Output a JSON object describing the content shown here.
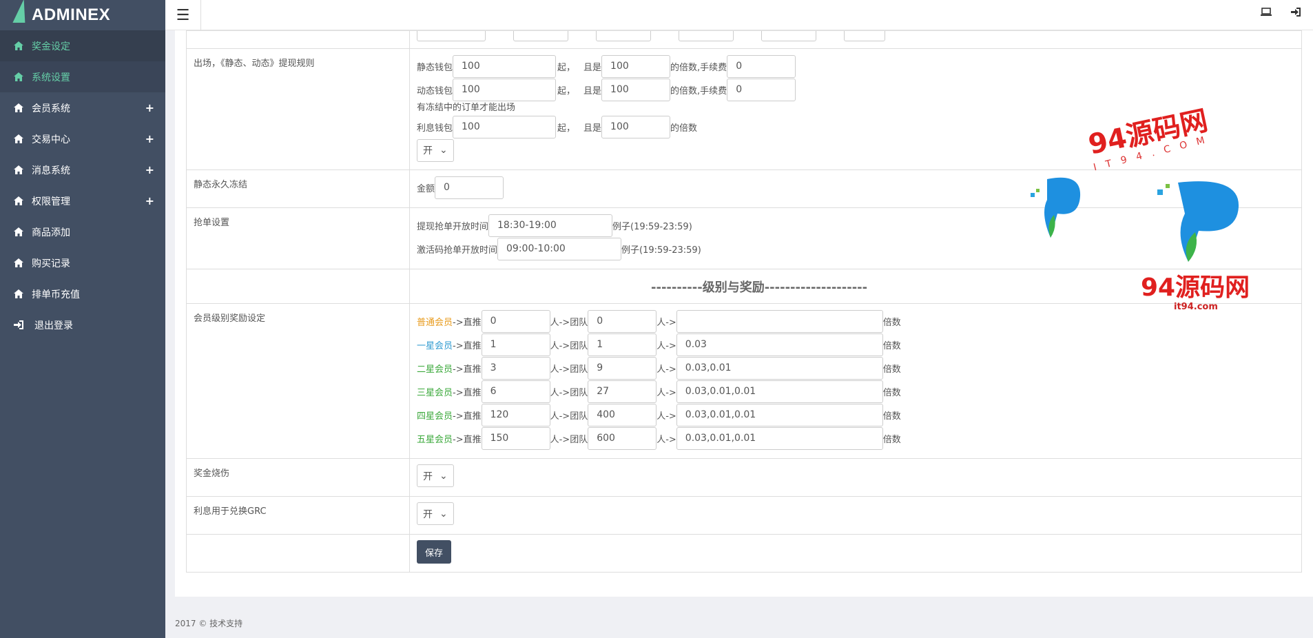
{
  "brand": {
    "name": "ADMINEX"
  },
  "sidebar": {
    "items": [
      {
        "label": "奖金设定",
        "icon": "home-icon"
      },
      {
        "label": "系统设置",
        "icon": "home-icon"
      },
      {
        "label": "会员系统",
        "icon": "home-icon",
        "expand": "+"
      },
      {
        "label": "交易中心",
        "icon": "home-icon",
        "expand": "+"
      },
      {
        "label": "消息系统",
        "icon": "home-icon",
        "expand": "+"
      },
      {
        "label": "权限管理",
        "icon": "home-icon",
        "expand": "+"
      },
      {
        "label": "商品添加",
        "icon": "home-icon"
      },
      {
        "label": "购买记录",
        "icon": "home-icon"
      },
      {
        "label": "排单币充值",
        "icon": "home-icon"
      },
      {
        "label": "退出登录",
        "icon": "sign-out-icon"
      }
    ]
  },
  "withdraw": {
    "label": "出场，《静态、动态》提现规则",
    "static_label": "静态钱包",
    "static_min": "100",
    "static_mult": "100",
    "static_fee": "0",
    "dynamic_label": "动态钱包",
    "dynamic_min": "100",
    "dynamic_mult": "100",
    "dynamic_fee": "0",
    "frozen_note": "有冻结中的订单才能出场",
    "interest_label": "利息钱包",
    "interest_min": "100",
    "interest_mult": "100",
    "start_text": "起，",
    "and_text": "且是",
    "mult_fee_text": "的倍数,手续费",
    "mult_text": "的倍数",
    "switch": "开"
  },
  "freeze": {
    "label": "静态永久冻结",
    "amount_label": "金额",
    "amount": "0"
  },
  "grab": {
    "label": "抢单设置",
    "withdraw_label": "提现抢单开放时间",
    "withdraw_time": "18:30-19:00",
    "activate_label": "激活码抢单开放时间",
    "activate_time": "09:00-10:00",
    "example": "例子(19:59-23:59)"
  },
  "section_title": "----------级别与奖励--------------------",
  "levels": {
    "label": "会员级别奖励设定",
    "direct_text": "->直推",
    "team_text": "人->团队",
    "person_text": "人->",
    "mult_text": "倍数",
    "rows": [
      {
        "name": "普通会员",
        "color": "#e89b1c",
        "direct": "0",
        "team": "0",
        "rate": ""
      },
      {
        "name": "一星会员",
        "color": "#2e9ad0",
        "direct": "1",
        "team": "1",
        "rate": "0.03"
      },
      {
        "name": "二星会员",
        "color": "#3aa83a",
        "direct": "3",
        "team": "9",
        "rate": "0.03,0.01"
      },
      {
        "name": "三星会员",
        "color": "#3aa83a",
        "direct": "6",
        "team": "27",
        "rate": "0.03,0.01,0.01"
      },
      {
        "name": "四星会员",
        "color": "#3aa83a",
        "direct": "120",
        "team": "400",
        "rate": "0.03,0.01,0.01"
      },
      {
        "name": "五星会员",
        "color": "#3aa83a",
        "direct": "150",
        "team": "600",
        "rate": "0.03,0.01,0.01"
      }
    ]
  },
  "burn": {
    "label": "奖金烧伤",
    "value": "开"
  },
  "grc": {
    "label": "利息用于兑换GRC",
    "value": "开"
  },
  "save_label": "保存",
  "footer": "2017 © 技术支持",
  "watermark": {
    "text": "94源码网",
    "sub": "it94.com",
    "sub2": "IT94.COM"
  }
}
